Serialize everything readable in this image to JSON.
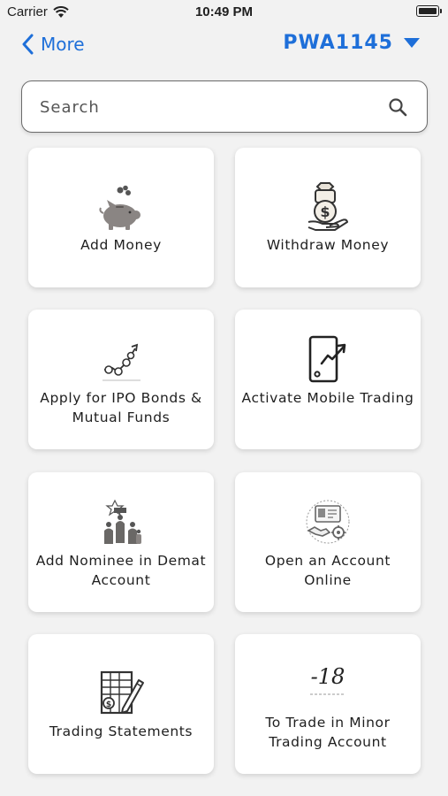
{
  "status_bar": {
    "carrier": "Carrier",
    "time": "10:49 PM"
  },
  "nav": {
    "back_label": "More",
    "account_label": "PWA1145"
  },
  "search": {
    "placeholder": "Search"
  },
  "cards": [
    {
      "label": "Add Money",
      "icon": "piggy-bank-icon"
    },
    {
      "label": "Withdraw Money",
      "icon": "cash-in-hand-icon"
    },
    {
      "label": "Apply for IPO Bonds & Mutual Funds",
      "icon": "growth-chart-icon"
    },
    {
      "label": "Activate Mobile Trading",
      "icon": "mobile-trading-icon"
    },
    {
      "label": "Add Nominee in Demat Account",
      "icon": "nominee-family-icon"
    },
    {
      "label": "Open an Account Online",
      "icon": "online-account-icon"
    },
    {
      "label": "Trading Statements",
      "icon": "statement-document-icon"
    },
    {
      "label": "To Trade in Minor Trading Account",
      "icon": "minor-18-icon",
      "icon_text": "-18"
    }
  ],
  "colors": {
    "accent": "#1e6fd9",
    "background": "#f2f2f2",
    "card": "#ffffff",
    "text": "#1e1e1e"
  }
}
